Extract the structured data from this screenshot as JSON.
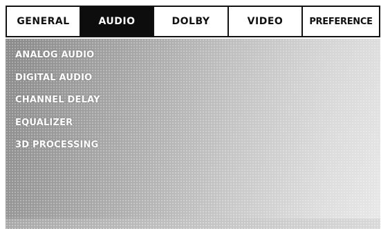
{
  "tabs": [
    {
      "label": "GENERAL",
      "active": false
    },
    {
      "label": "AUDIO",
      "active": true
    },
    {
      "label": "DOLBY",
      "active": false
    },
    {
      "label": "VIDEO",
      "active": false
    },
    {
      "label": "PREFERENCE",
      "active": false
    }
  ],
  "menu": {
    "items": [
      {
        "label": "ANALOG AUDIO"
      },
      {
        "label": "DIGITAL AUDIO"
      },
      {
        "label": "CHANNEL DELAY"
      },
      {
        "label": "EQUALIZER"
      },
      {
        "label": "3D PROCESSING"
      }
    ]
  },
  "colors": {
    "active_tab_bg": "#0d0d0d",
    "active_tab_text": "#ffffff",
    "tab_text": "#111111",
    "menu_text": "#ffffff"
  }
}
